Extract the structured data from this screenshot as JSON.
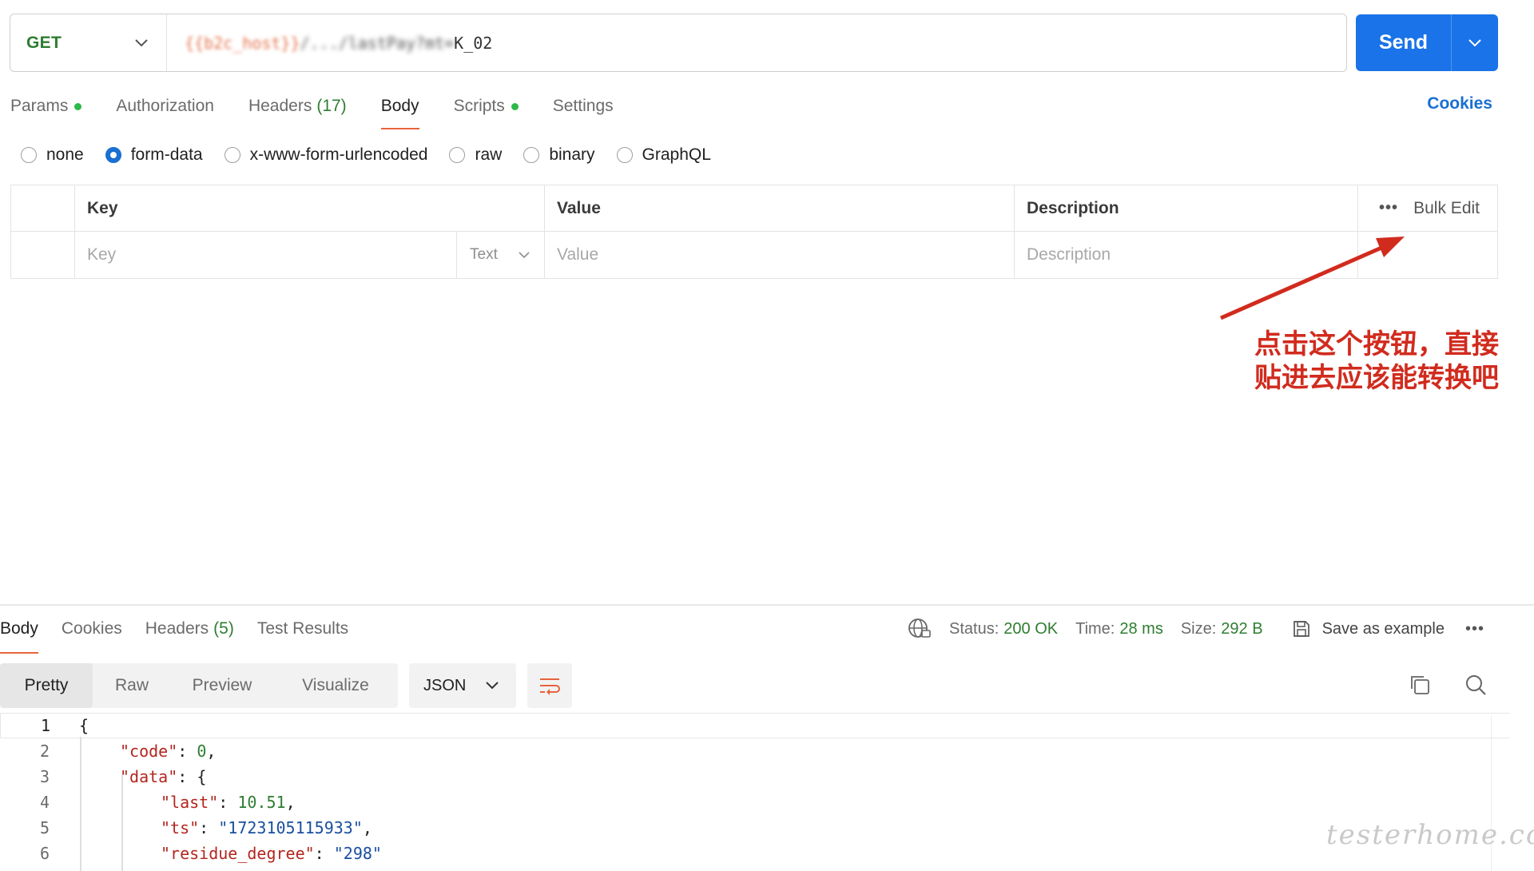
{
  "request": {
    "method": "GET",
    "url_var": "{{b2c_host}}",
    "url_mid": "/.../lastPay?mt=",
    "url_end": "K_02",
    "send_label": "Send"
  },
  "req_tabs": [
    {
      "label": "Params",
      "dot": true
    },
    {
      "label": "Authorization"
    },
    {
      "label": "Headers",
      "count": "(17)"
    },
    {
      "label": "Body",
      "active": true
    },
    {
      "label": "Scripts",
      "dot": true
    },
    {
      "label": "Settings"
    }
  ],
  "cookies_label": "Cookies",
  "body_types": [
    {
      "label": "none"
    },
    {
      "label": "form-data",
      "checked": true
    },
    {
      "label": "x-www-form-urlencoded"
    },
    {
      "label": "raw"
    },
    {
      "label": "binary"
    },
    {
      "label": "GraphQL"
    }
  ],
  "params_table": {
    "headers": {
      "key": "Key",
      "value": "Value",
      "description": "Description",
      "bulk_edit": "Bulk Edit",
      "more": "•••"
    },
    "placeholders": {
      "key": "Key",
      "type": "Text",
      "value": "Value",
      "description": "Description"
    }
  },
  "annotation": {
    "line1": "点击这个按钮，直接",
    "line2": "贴进去应该能转换吧",
    "color": "#d12b1e"
  },
  "resp_tabs": [
    {
      "label": "Body",
      "active": true
    },
    {
      "label": "Cookies"
    },
    {
      "label": "Headers",
      "count": "(5)"
    },
    {
      "label": "Test Results"
    }
  ],
  "status": {
    "status_label": "Status:",
    "status_value": "200 OK",
    "time_label": "Time:",
    "time_value": "28 ms",
    "size_label": "Size:",
    "size_value": "292 B",
    "save_label": "Save as example",
    "more": "•••"
  },
  "view_modes": [
    {
      "label": "Pretty",
      "active": true
    },
    {
      "label": "Raw"
    },
    {
      "label": "Preview"
    },
    {
      "label": "Visualize"
    }
  ],
  "format": "JSON",
  "code_lines": [
    "1",
    "2",
    "3",
    "4",
    "5",
    "6"
  ],
  "json": {
    "brace_open": "{",
    "code_key": "\"code\"",
    "code_val": "0",
    "data_key": "\"data\"",
    "last_key": "\"last\"",
    "last_val": "10.51",
    "ts_key": "\"ts\"",
    "ts_val": "\"1723105115933\"",
    "rd_key": "\"residue_degree\"",
    "rd_val": "\"298\""
  },
  "watermark": "testerhome.com",
  "colors": {
    "accent": "#1a73e8",
    "success": "#2f7d32",
    "tab_underline": "#e8633a",
    "link": "#1a6fd1"
  }
}
